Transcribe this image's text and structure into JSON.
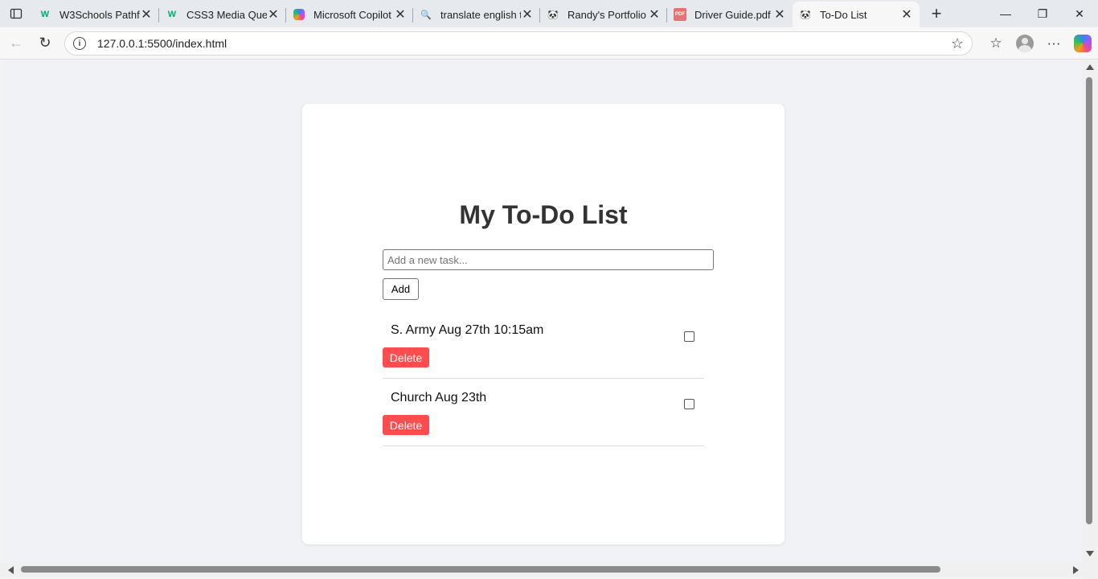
{
  "browser": {
    "tabs": [
      {
        "title": "W3Schools Pathfir",
        "icon": "w3schools-icon",
        "favicon_text": "W"
      },
      {
        "title": "CSS3 Media Queri",
        "icon": "w3schools-icon",
        "favicon_text": "W"
      },
      {
        "title": "Microsoft Copilot",
        "icon": "copilot-icon",
        "favicon_text": ""
      },
      {
        "title": "translate english t",
        "icon": "search-icon",
        "favicon_text": "🔍"
      },
      {
        "title": "Randy's Portfolio",
        "icon": "panda-icon",
        "favicon_text": "🐼"
      },
      {
        "title": "Driver Guide.pdf",
        "icon": "pdf-icon",
        "favicon_text": "PDF"
      },
      {
        "title": "To-Do List",
        "icon": "panda-icon",
        "favicon_text": "🐼",
        "active": true
      }
    ],
    "address": {
      "url": "127.0.0.1:5500/index.html"
    }
  },
  "app": {
    "title": "My To-Do List",
    "input_placeholder": "Add a new task...",
    "add_label": "Add",
    "tasks": [
      {
        "text": "S. Army Aug 27th 10:15am",
        "delete_label": "Delete",
        "checked": false
      },
      {
        "text": "Church Aug 23th",
        "delete_label": "Delete",
        "checked": false
      }
    ]
  },
  "colors": {
    "page_bg": "#f0f2f5",
    "card_bg": "#ffffff",
    "delete_button": "#ff4d4f",
    "heading": "#333333"
  }
}
